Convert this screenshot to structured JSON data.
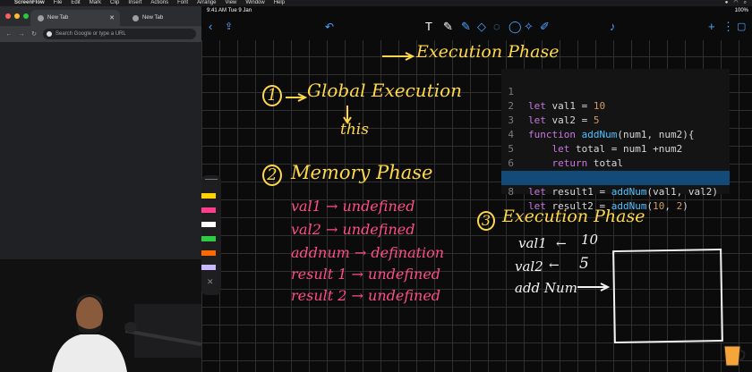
{
  "menubar": {
    "app": "ScreenFlow",
    "items": [
      "File",
      "Edit",
      "Mark",
      "Clip",
      "Insert",
      "Actions",
      "Font",
      "Arrange",
      "View",
      "Window",
      "Help"
    ]
  },
  "browser": {
    "tabs": [
      {
        "label": "New Tab"
      },
      {
        "label": "New Tab"
      }
    ],
    "omnibox_placeholder": "Search Google or type a URL",
    "traffic_colors": [
      "#ff5f57",
      "#febc2e",
      "#28c840"
    ]
  },
  "notes": {
    "status_time": "9:41 AM  Tue 9 Jan",
    "status_right": "100%",
    "toolbar_icons": [
      "chevron-left-icon",
      "share-icon",
      "undo-icon",
      "text-tool-icon",
      "pen-icon",
      "marker-icon",
      "eraser-icon",
      "lasso-icon",
      "shapes-icon",
      "pointer-icon",
      "pencil-icon",
      "mic-icon",
      "plus-icon",
      "more-icon",
      "page-icon"
    ],
    "headings": {
      "top": "Execution Phase",
      "step1": "Global Execution",
      "step1_num": "1",
      "this": "this",
      "step2": "Memory Phase",
      "step2_num": "2",
      "step3": "Execution Phase",
      "step3_num": "3"
    },
    "memory_list": [
      "val1 → undefined",
      "val2 → undefined",
      "addnum → defination",
      "result 1 → undefined",
      "result 2 → undefined"
    ],
    "exec_list": [
      {
        "name": "val1",
        "value": "10"
      },
      {
        "name": "val2",
        "value": "5"
      },
      {
        "name": "add Num",
        "value": ""
      }
    ]
  },
  "code": {
    "lines": [
      {
        "n": "1",
        "text": "let val1 = 10"
      },
      {
        "n": "2",
        "text": "let val2 = 5"
      },
      {
        "n": "3",
        "text": "function addNum(num1, num2){"
      },
      {
        "n": "4",
        "text": "    let total = num1 +num2"
      },
      {
        "n": "5",
        "text": "    return total"
      },
      {
        "n": "6",
        "text": "}"
      },
      {
        "n": "7",
        "text": "let result1 = addNum(val1, val2)"
      },
      {
        "n": "8",
        "text": "let result2 = addNum(10, 2)"
      }
    ]
  },
  "palette": [
    "#ffd200",
    "#ff3d8b",
    "#ffffff",
    "#2ecc40",
    "#ff6a00",
    "#c9b8ff"
  ]
}
